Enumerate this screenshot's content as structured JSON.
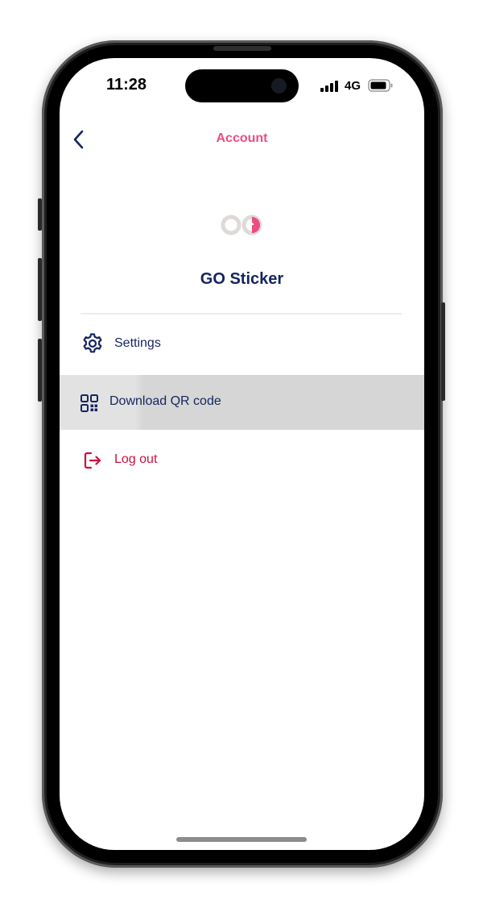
{
  "status_bar": {
    "time": "11:28",
    "network": "4G",
    "signal_icon": "signal-bars-icon",
    "battery_icon": "battery-icon"
  },
  "header": {
    "back_icon": "chevron-left-icon",
    "title": "Account"
  },
  "profile": {
    "logo_icon": "infinity-logo-icon",
    "name": "GO Sticker"
  },
  "menu": {
    "settings": {
      "icon": "gear-icon",
      "label": "Settings"
    },
    "download_qr": {
      "icon": "qr-code-icon",
      "label": "Download QR code"
    },
    "log_out": {
      "icon": "logout-icon",
      "label": "Log out"
    }
  },
  "colors": {
    "accent": "#ec4c81",
    "primary_text": "#15255e",
    "danger": "#c8133f",
    "pressed_row": "#d6d6d6"
  }
}
